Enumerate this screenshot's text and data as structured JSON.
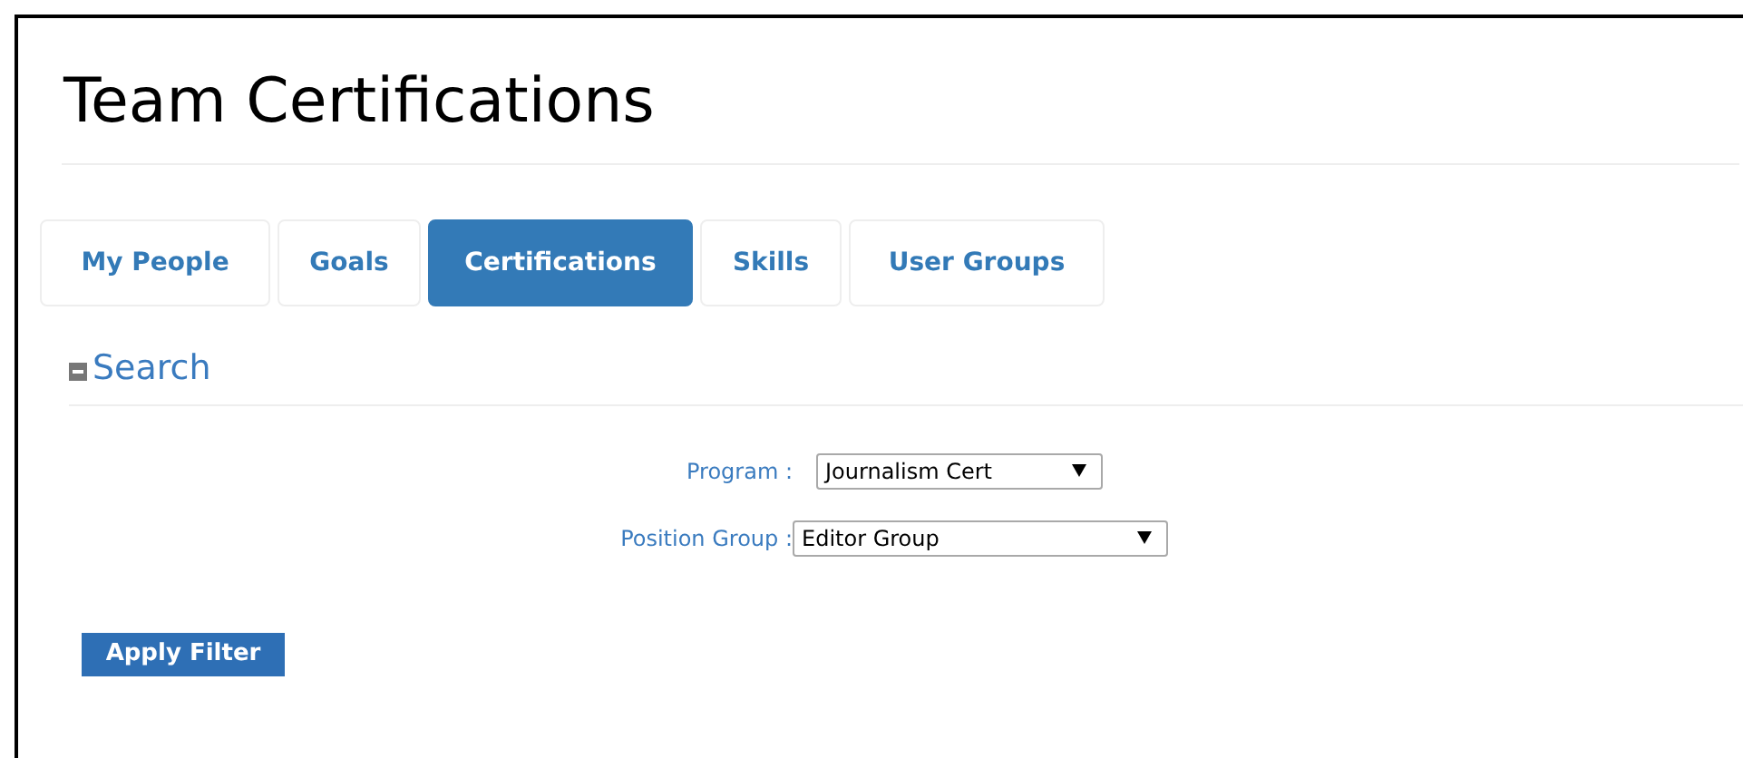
{
  "page": {
    "title": "Team Certifications"
  },
  "tabs": [
    {
      "label": "My People",
      "selected": false
    },
    {
      "label": "Goals",
      "selected": false
    },
    {
      "label": "Certifications",
      "selected": true
    },
    {
      "label": "Skills",
      "selected": false
    },
    {
      "label": "User Groups",
      "selected": false
    }
  ],
  "search": {
    "title": "Search",
    "expanded": true,
    "filters": [
      {
        "label": "Program :",
        "value": "Journalism Cert"
      },
      {
        "label": "Position Group :",
        "value": "Editor Group"
      }
    ],
    "button": "Apply Filter"
  }
}
